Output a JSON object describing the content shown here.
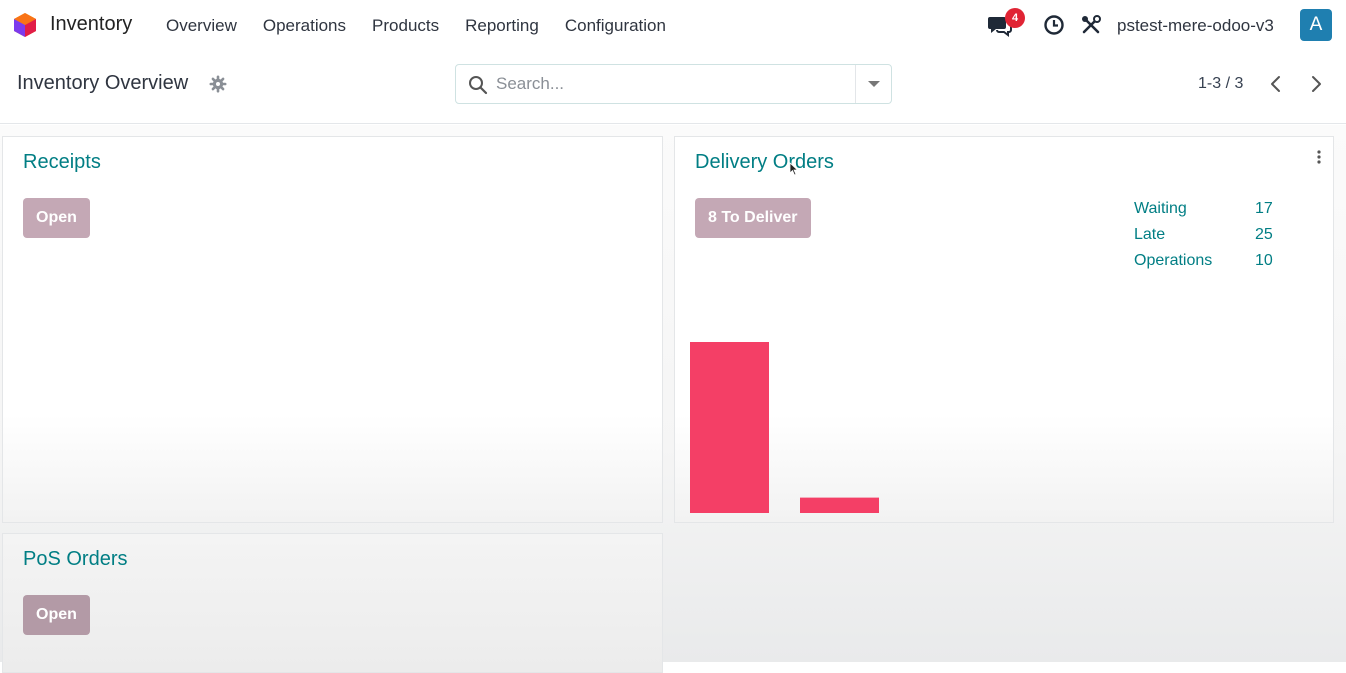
{
  "navbar": {
    "app_name": "Inventory",
    "menu": [
      "Overview",
      "Operations",
      "Products",
      "Reporting",
      "Configuration"
    ],
    "chat_badge": "4",
    "db_name": "pstest-mere-odoo-v3",
    "avatar_letter": "A"
  },
  "control_panel": {
    "title": "Inventory Overview",
    "search_placeholder": "Search...",
    "pager": "1-3 / 3"
  },
  "cards": {
    "receipts": {
      "title": "Receipts",
      "button": "Open"
    },
    "delivery": {
      "title": "Delivery Orders",
      "button": "8 To Deliver",
      "stats": [
        {
          "label": "Waiting",
          "value": "17"
        },
        {
          "label": "Late",
          "value": "25"
        },
        {
          "label": "Operations",
          "value": "10"
        }
      ]
    },
    "pos": {
      "title": "PoS Orders",
      "button": "Open"
    }
  },
  "colors": {
    "accent": "#017e84",
    "button": "#c4a8b5",
    "bar": "#f43f66",
    "badge": "#e02434",
    "avatar": "#1f7fb0"
  },
  "chart_data": {
    "type": "bar",
    "categories": [
      "",
      ""
    ],
    "values": [
      100,
      9
    ],
    "ylim": [
      0,
      100
    ],
    "grid": false,
    "legend": "none"
  }
}
